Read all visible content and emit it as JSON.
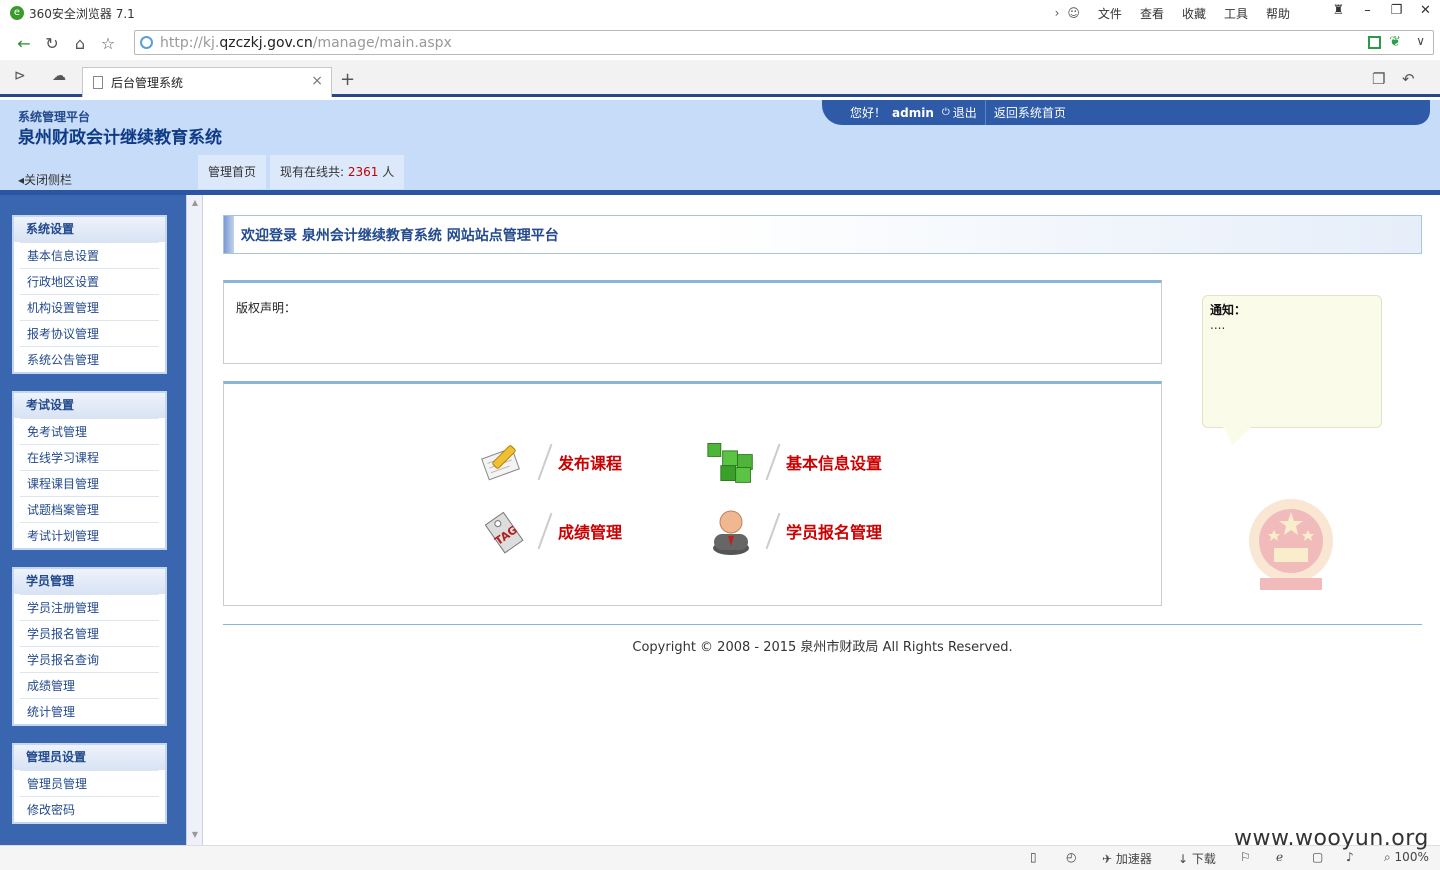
{
  "browser": {
    "title": "360安全浏览器 7.1",
    "menu": [
      "文件",
      "查看",
      "收藏",
      "工具",
      "帮助"
    ],
    "url_prefix": "http://kj.",
    "url_domain": "qzczkj.gov.cn",
    "url_path": "/manage/main.aspx",
    "tab_title": "后台管理系统",
    "status_items": {
      "accelerator": "加速器",
      "download": "下载",
      "zoom": "100%"
    }
  },
  "header": {
    "subtitle": "系统管理平台",
    "title": "泉州财政会计继续教育系统",
    "greeting": "您好！",
    "username": "admin",
    "logout": "退出",
    "home_link": "返回系统首页",
    "close_sidebar": "关闭侧栏",
    "tabs": {
      "home": "管理首页",
      "online_prefix": "现有在线共:",
      "online_count": "2361",
      "online_suffix": "人"
    }
  },
  "sidebar": {
    "groups": [
      {
        "title": "系统设置",
        "items": [
          "基本信息设置",
          "行政地区设置",
          "机构设置管理",
          "报考协议管理",
          "系统公告管理"
        ]
      },
      {
        "title": "考试设置",
        "items": [
          "免考试管理",
          "在线学习课程",
          "课程课目管理",
          "试题档案管理",
          "考试计划管理"
        ]
      },
      {
        "title": "学员管理",
        "items": [
          "学员注册管理",
          "学员报名管理",
          "学员报名查询",
          "成绩管理",
          "统计管理"
        ]
      },
      {
        "title": "管理员设置",
        "items": [
          "管理员管理",
          "修改密码"
        ]
      }
    ]
  },
  "main": {
    "welcome": "欢迎登录 泉州会计继续教育系统 网站站点管理平台",
    "copyright_label": "版权声明：",
    "quick_links": {
      "publish_course": "发布课程",
      "basic_info": "基本信息设置",
      "grades": "成绩管理",
      "enrollment": "学员报名管理"
    },
    "notice_title": "通知：",
    "notice_content": "....",
    "footer": "Copyright © 2008 - 2015 泉州市财政局 All Rights Reserved."
  },
  "watermark": "www.wooyun.org",
  "colors": {
    "header_bg": "#c7dcf9",
    "sidebar_bg": "#3a66b0",
    "link_red": "#cc0000",
    "title_blue": "#0f3a86"
  }
}
